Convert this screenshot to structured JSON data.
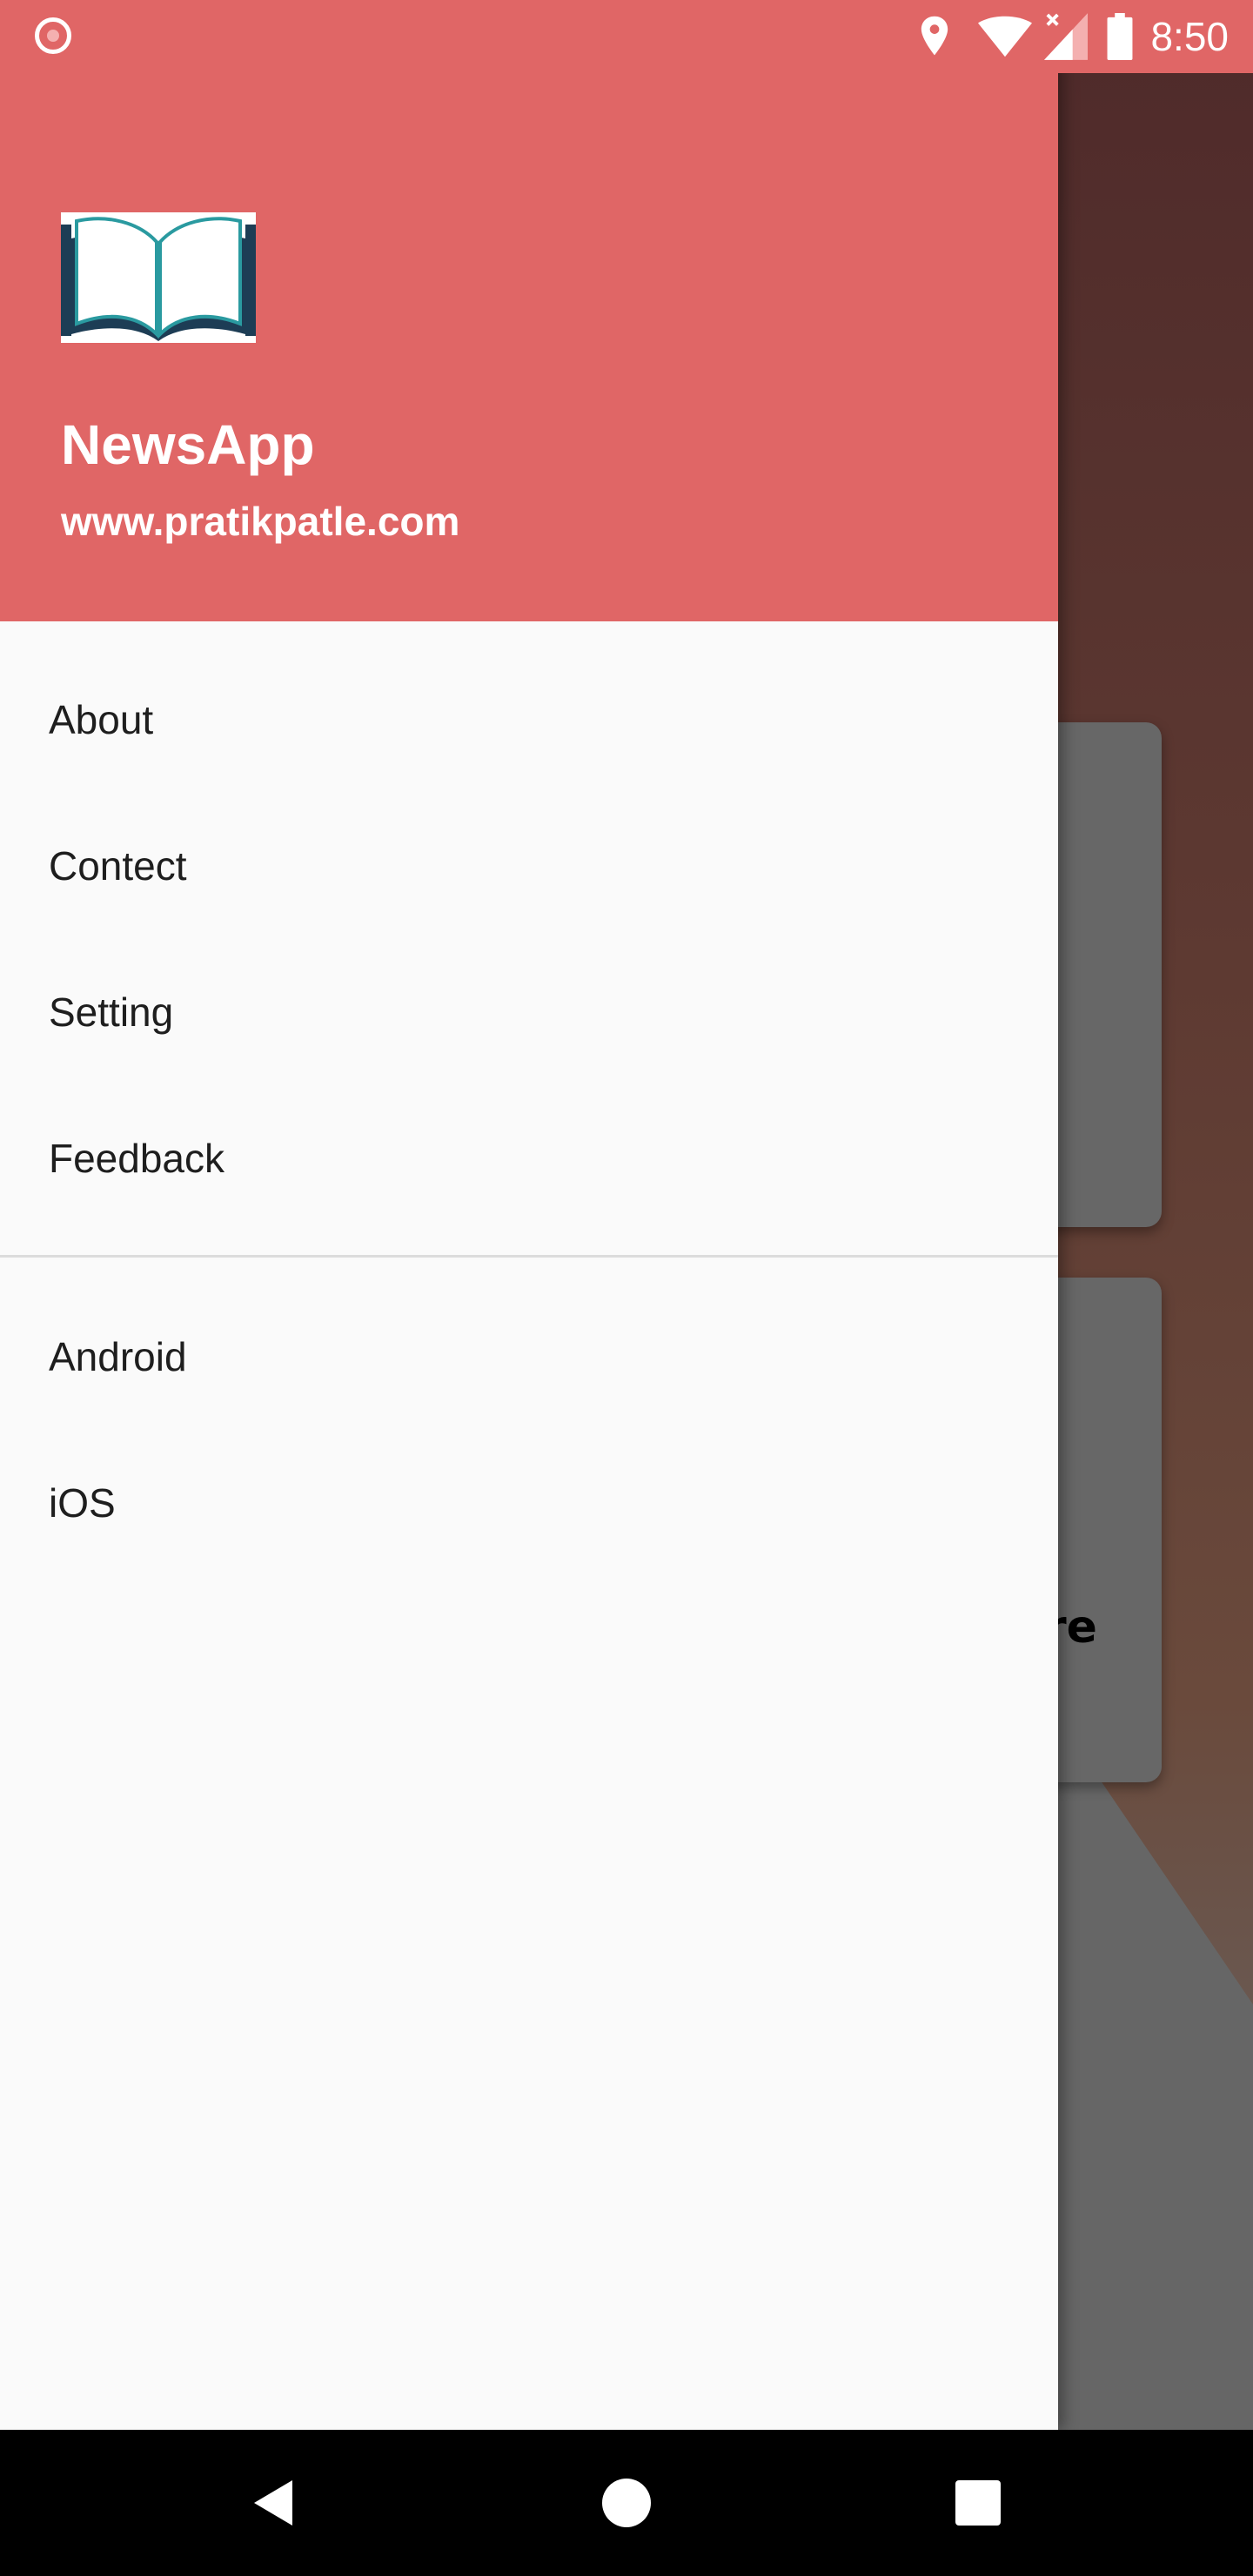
{
  "status_bar": {
    "time": "8:50",
    "icons": [
      "record-icon",
      "location-icon",
      "wifi-icon",
      "signal-icon",
      "battery-icon"
    ],
    "color": "#e06666"
  },
  "drawer": {
    "header": {
      "logo": "book-logo",
      "title": "NewsApp",
      "subtitle": "www.pratikpatle.com",
      "color": "#e06666"
    },
    "primary_items": [
      {
        "label": "About"
      },
      {
        "label": "Contect"
      },
      {
        "label": "Setting"
      },
      {
        "label": "Feedback"
      }
    ],
    "secondary_items": [
      {
        "label": "Android"
      },
      {
        "label": "iOS"
      }
    ]
  },
  "background": {
    "partial_card_text": "re"
  },
  "nav_bar": {
    "buttons": [
      "back-icon",
      "home-icon",
      "recents-icon"
    ]
  }
}
